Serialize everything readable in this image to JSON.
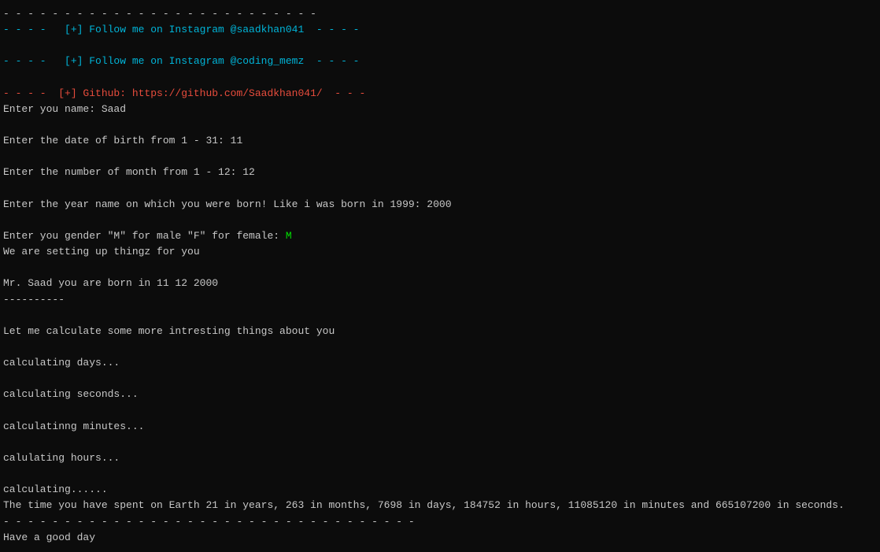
{
  "terminal": {
    "lines": [
      {
        "text": "- - - - - - - - - - - - - - - - - - - - - - - - - -",
        "color": "white"
      },
      {
        "text": "- - - -   [+] Follow me on Instagram @saadkhan041  - - - -",
        "color": "cyan"
      },
      {
        "text": "",
        "color": "white"
      },
      {
        "text": "- - - -   [+] Follow me on Instagram @coding_memz  - - - -",
        "color": "cyan"
      },
      {
        "text": "",
        "color": "white"
      },
      {
        "text": "- - - -  [+] Github: https://github.com/Saadkhan041/  - - -",
        "color": "red"
      },
      {
        "text": "Enter you name: Saad",
        "color": "white"
      },
      {
        "text": "",
        "color": "white"
      },
      {
        "text": "Enter the date of birth from 1 - 31: 11",
        "color": "white"
      },
      {
        "text": "",
        "color": "white"
      },
      {
        "text": "Enter the number of month from 1 - 12: 12",
        "color": "white"
      },
      {
        "text": "",
        "color": "white"
      },
      {
        "text": "Enter the year name on which you were born! Like i was born in 1999: 2000",
        "color": "white"
      },
      {
        "text": "",
        "color": "white"
      },
      {
        "text": "Enter you gender \"M\" for male \"F\" for female: M",
        "color": "white",
        "has_green": true,
        "green_char": "M",
        "base": "Enter you gender \"M\" for male \"F\" for female: "
      },
      {
        "text": "We are setting up thingz for you",
        "color": "white"
      },
      {
        "text": "",
        "color": "white"
      },
      {
        "text": "Mr. Saad you are born in 11 12 2000",
        "color": "white"
      },
      {
        "text": "----------",
        "color": "white"
      },
      {
        "text": "",
        "color": "white"
      },
      {
        "text": "Let me calculate some more intresting things about you",
        "color": "white"
      },
      {
        "text": "",
        "color": "white"
      },
      {
        "text": "calculating days...",
        "color": "white"
      },
      {
        "text": "",
        "color": "white"
      },
      {
        "text": "calculating seconds...",
        "color": "white"
      },
      {
        "text": "",
        "color": "white"
      },
      {
        "text": "calculatinng minutes...",
        "color": "white"
      },
      {
        "text": "",
        "color": "white"
      },
      {
        "text": "calulating hours...",
        "color": "white"
      },
      {
        "text": "",
        "color": "white"
      },
      {
        "text": "calculating......",
        "color": "white"
      },
      {
        "text": "The time you have spent on Earth 21 in years, 263 in months, 7698 in days, 184752 in hours, 11085120 in minutes and 665107200 in seconds.",
        "color": "white"
      },
      {
        "text": "- - - - - - - - - - - - - - - - - - - - - - - - - - - - - - - - - -",
        "color": "white"
      },
      {
        "text": "Have a good day",
        "color": "white"
      }
    ]
  }
}
